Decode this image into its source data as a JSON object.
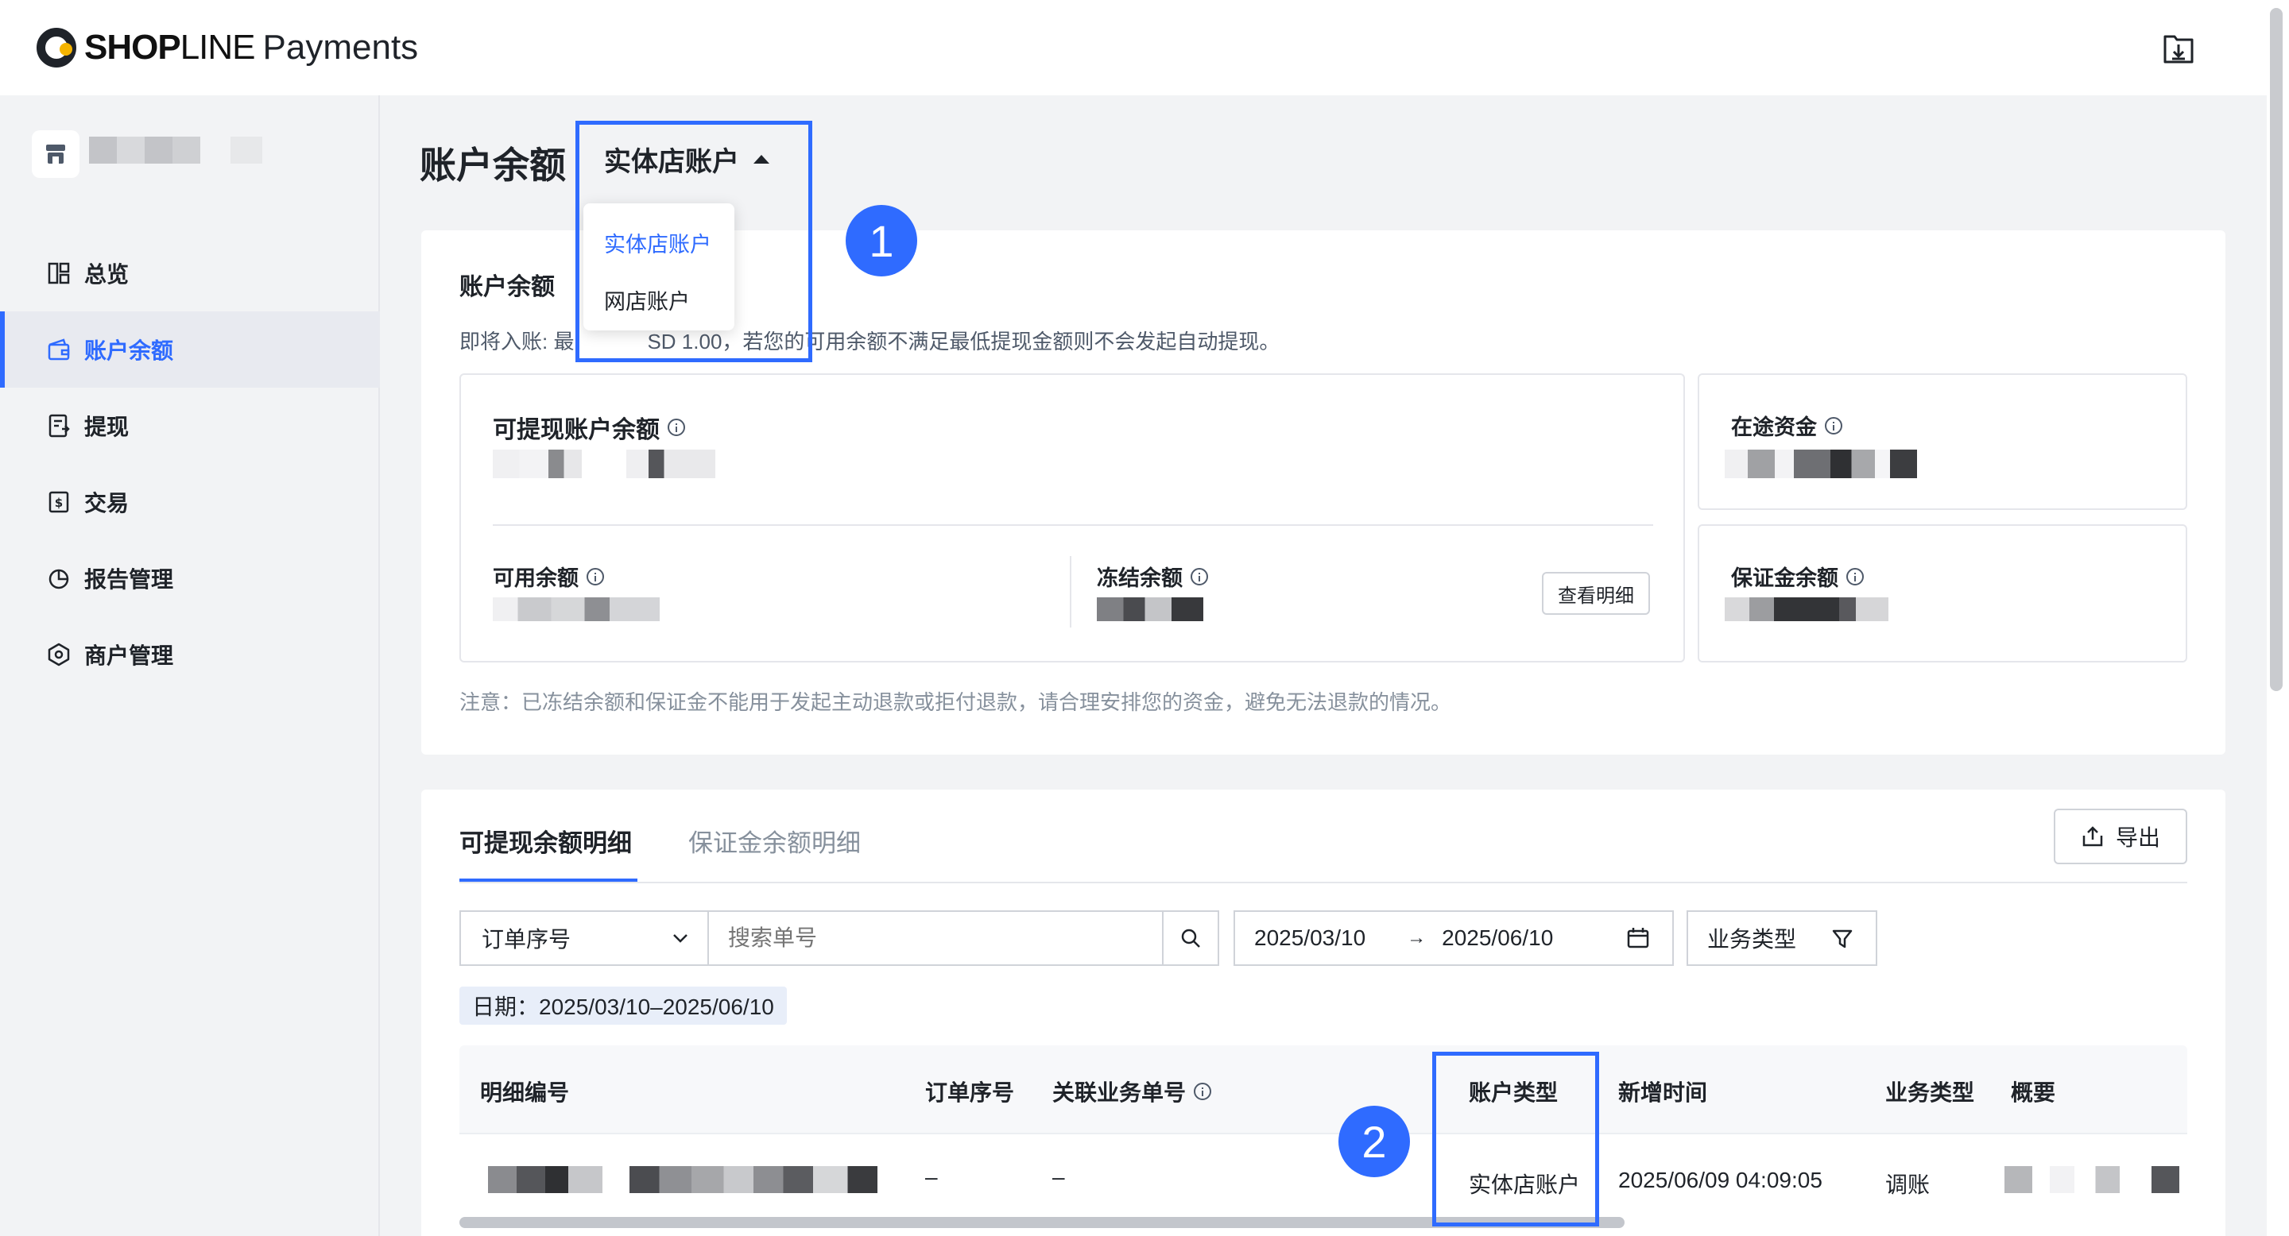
{
  "header": {
    "logo_brand": "SHOP",
    "logo_brand_rest": "LINE",
    "logo_product": "Payments",
    "download_icon": "download-icon"
  },
  "sidebar": {
    "items": [
      {
        "label": "总览",
        "icon": "dashboard-icon"
      },
      {
        "label": "账户余额",
        "icon": "wallet-icon",
        "active": true
      },
      {
        "label": "提现",
        "icon": "withdraw-icon"
      },
      {
        "label": "交易",
        "icon": "transaction-icon"
      },
      {
        "label": "报告管理",
        "icon": "report-icon"
      },
      {
        "label": "商户管理",
        "icon": "merchant-icon"
      }
    ]
  },
  "page": {
    "title": "账户余额",
    "account_select": "实体店账户",
    "dropdown_options": [
      "实体店账户",
      "网店账户"
    ],
    "callout_1": "1",
    "callout_2": "2"
  },
  "balance_card": {
    "title": "账户余额",
    "notice_prefix": "即将入账: ",
    "notice_partial_left": "最",
    "notice_partial_right": "SD 1.00",
    "notice_suffix": "，若您的可用余额不满足最低提现金额则不会发起自动提现。",
    "withdrawable_label": "可提现账户余额",
    "available_label": "可用余额",
    "frozen_label": "冻结余额",
    "view_detail_button": "查看明细",
    "in_transit_label": "在途资金",
    "deposit_label": "保证金余额",
    "footer_note": "注意：已冻结余额和保证金不能用于发起主动退款或拒付退款，请合理安排您的资金，避免无法退款的情况。"
  },
  "detail": {
    "tabs": [
      "可提现余额明细",
      "保证金余额明细"
    ],
    "export_button": "导出",
    "search_type": "订单序号",
    "search_placeholder": "搜索单号",
    "date_start": "2025/03/10",
    "date_arrow": "→",
    "date_end": "2025/06/10",
    "business_type_filter": "业务类型",
    "date_tag": "日期：2025/03/10–2025/06/10",
    "columns": [
      "明细编号",
      "订单序号",
      "关联业务单号",
      "账户类型",
      "新增时间",
      "业务类型",
      "概要"
    ],
    "rows": [
      {
        "order_no": "–",
        "related_no": "–",
        "account_type": "实体店账户",
        "created_at": "2025/06/09 04:09:05",
        "business_type": "调账"
      }
    ]
  },
  "colors": {
    "accent": "#2f6bff",
    "text": "#1f2329",
    "muted": "#86909c",
    "background": "#f2f3f5",
    "logo_yellow": "#f5b400"
  }
}
